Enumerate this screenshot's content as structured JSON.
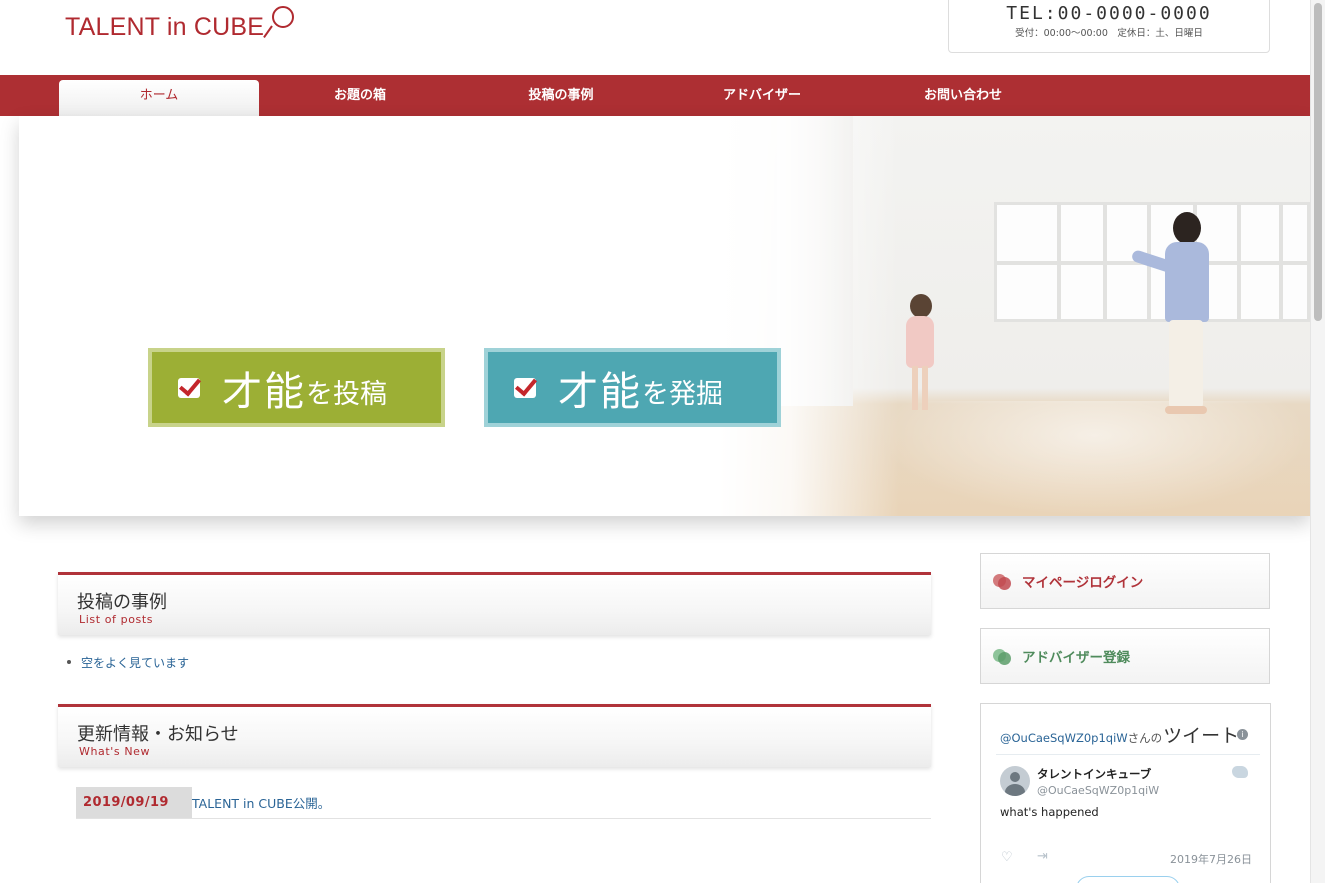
{
  "header": {
    "logo_text": "TALENT in CUBE",
    "tel": "TEL:00-0000-0000",
    "hours": "受付：00:00〜00:00　定休日：土、日曜日"
  },
  "nav": {
    "items": [
      {
        "label": "ホーム",
        "active": true
      },
      {
        "label": "お題の箱",
        "active": false
      },
      {
        "label": "投稿の事例",
        "active": false
      },
      {
        "label": "アドバイザー",
        "active": false
      },
      {
        "label": "お問い合わせ",
        "active": false
      }
    ]
  },
  "hero": {
    "cta_post": {
      "big": "才能",
      "small": "を投稿",
      "color": "#9caf35"
    },
    "cta_discover": {
      "big": "才能",
      "small": "を発掘",
      "color": "#4ea7b2"
    }
  },
  "posts_section": {
    "title": "投稿の事例",
    "subtitle": "List of posts",
    "items": [
      "空をよく見ています"
    ]
  },
  "news_section": {
    "title": "更新情報・お知らせ",
    "subtitle": "What's New",
    "items": [
      {
        "date": "2019/09/19",
        "text": "TALENT in CUBE公開。"
      }
    ]
  },
  "sidebar": {
    "login_label": "マイページログイン",
    "advisor_label": "アドバイザー登録",
    "twitter": {
      "handle": "@OuCaeSqWZ0p1qiW",
      "suffix": "さんの",
      "title": "ツイート",
      "name": "タレントインキューブ",
      "username": "@OuCaeSqWZ0p1qiW",
      "text": "what's happened",
      "date": "2019年7月26日"
    }
  },
  "colors": {
    "brand": "#ad2f33",
    "link": "#2a6496"
  }
}
